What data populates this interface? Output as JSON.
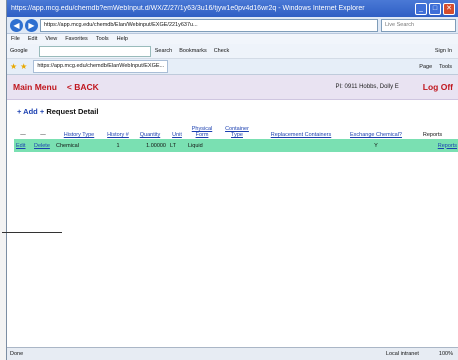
{
  "window": {
    "title": "https://app.mcg.edu/chemdb?emWebInput.d/WX/Z/27/1y63/3u16/tjyw1e0pv4d16wr2q - Windows Internet Explorer",
    "controls": [
      "_",
      "□",
      "✕"
    ]
  },
  "address": {
    "url": "https://app.mcg.edu/chemdb/Elan/Webinput/EXGE/221y637u...",
    "search_placeholder": "Live Search"
  },
  "menubar": [
    "File",
    "Edit",
    "View",
    "Favorites",
    "Tools",
    "Help"
  ],
  "googlebar": {
    "label": "Google",
    "items": [
      "Search",
      "Bookmarks",
      "Check",
      "Sign In"
    ]
  },
  "tabbar": {
    "tab_title": "https://app.mcg.edu/chemdb/ElanWebInput/EXGE...",
    "tools": [
      "Page",
      "Tools"
    ]
  },
  "app": {
    "main_menu": "Main Menu",
    "back": "< BACK",
    "user": "PI:    0911   Hobbs, Dolly E",
    "logoff": "Log Off",
    "title_add": "+ Add +",
    "title_text": "Request Detail"
  },
  "table": {
    "headers": [
      "—",
      "—",
      "History Type",
      "History #",
      "Quantity",
      "Unit",
      "Physical Form",
      "Container Type",
      "Replacement Containers",
      "Exchange Chemical?",
      "Reports"
    ],
    "row": [
      "Edit",
      "Delete",
      "Chemical",
      "1",
      "1.00000",
      "LT",
      "Liquid",
      "",
      "",
      "Y",
      "Reports"
    ]
  },
  "status": {
    "left": "Done",
    "zone": "Local intranet",
    "zoom": "100%"
  }
}
